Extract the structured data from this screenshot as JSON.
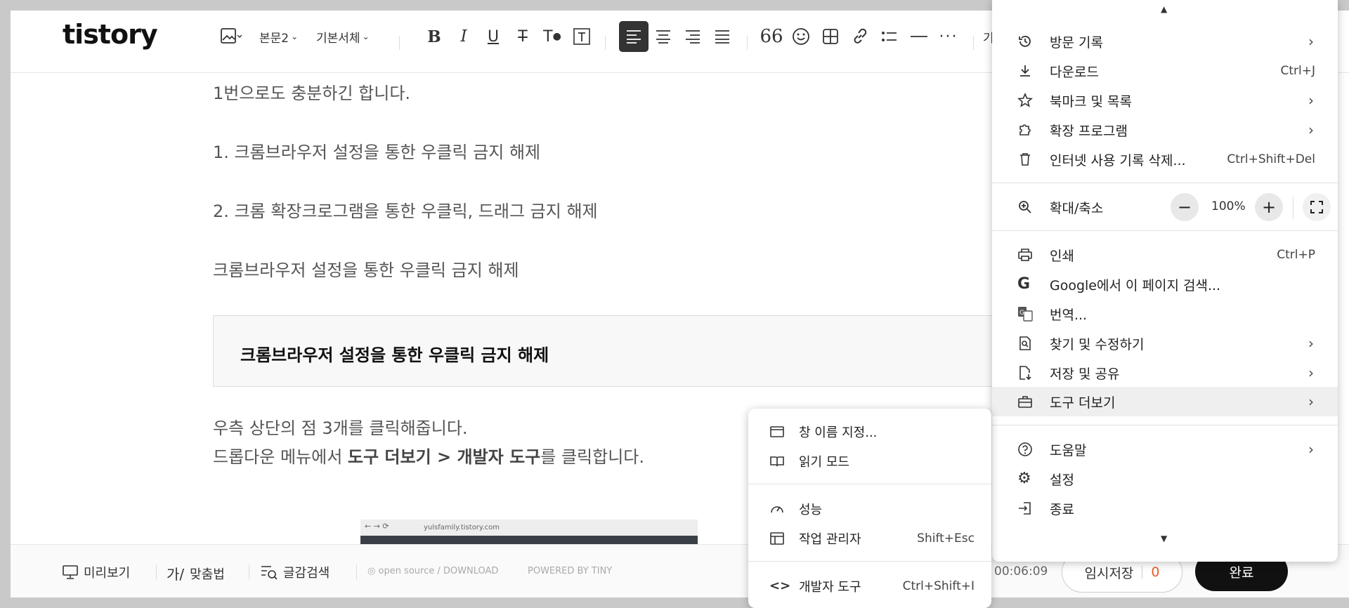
{
  "app": {
    "logo": "tistory"
  },
  "toolbar": {
    "paragraph_style": "본문2",
    "font": "기본서체",
    "overflow_text": "기"
  },
  "content": {
    "lines": [
      "1번으로도 충분하긴 합니다.",
      "1. 크롬브라우저 설정을 통한 우클릭 금지 해제",
      "2. 크롬 확장크로그램을 통한 우클릭, 드래그 금지 해제",
      "크롬브라우저 설정을 통한 우클릭 금지 해제"
    ],
    "quote": "크롬브라우저 설정을 통한 우클릭 금지 해제",
    "para1": "우측 상단의 점 3개를 클릭해줍니다.",
    "para2_prefix": "드롭다운 메뉴에서 ",
    "para2_bold": "도구 더보기 > 개발자 도구",
    "para2_suffix": "를 클릭합니다.",
    "image_address": "yulsfamily.tistory.com"
  },
  "bottom": {
    "preview": "미리보기",
    "spellcheck": "맞춤법",
    "search": "글감검색",
    "opensource": "open source / DOWNLOAD",
    "powered": "POWERED BY TINY",
    "timer": "00:06:09",
    "temp_save": "임시저장",
    "temp_count": "0",
    "done": "완료"
  },
  "menu": {
    "history": "방문 기록",
    "downloads": "다운로드",
    "downloads_sc": "Ctrl+J",
    "bookmarks": "북마크 및 목록",
    "extensions": "확장 프로그램",
    "clear": "인터넷 사용 기록 삭제...",
    "clear_sc": "Ctrl+Shift+Del",
    "zoom": "확대/축소",
    "zoom_value": "100%",
    "print": "인쇄",
    "print_sc": "Ctrl+P",
    "google": "Google에서 이 페이지 검색...",
    "translate": "번역...",
    "find": "찾기 및 수정하기",
    "save": "저장 및 공유",
    "more_tools": "도구 더보기",
    "help": "도움말",
    "settings": "설정",
    "exit": "종료"
  },
  "submenu": {
    "name_window": "창 이름 지정...",
    "reading_mode": "읽기 모드",
    "performance": "성능",
    "task_manager": "작업 관리자",
    "task_manager_sc": "Shift+Esc",
    "dev_tools": "개발자 도구",
    "dev_tools_sc": "Ctrl+Shift+I"
  }
}
